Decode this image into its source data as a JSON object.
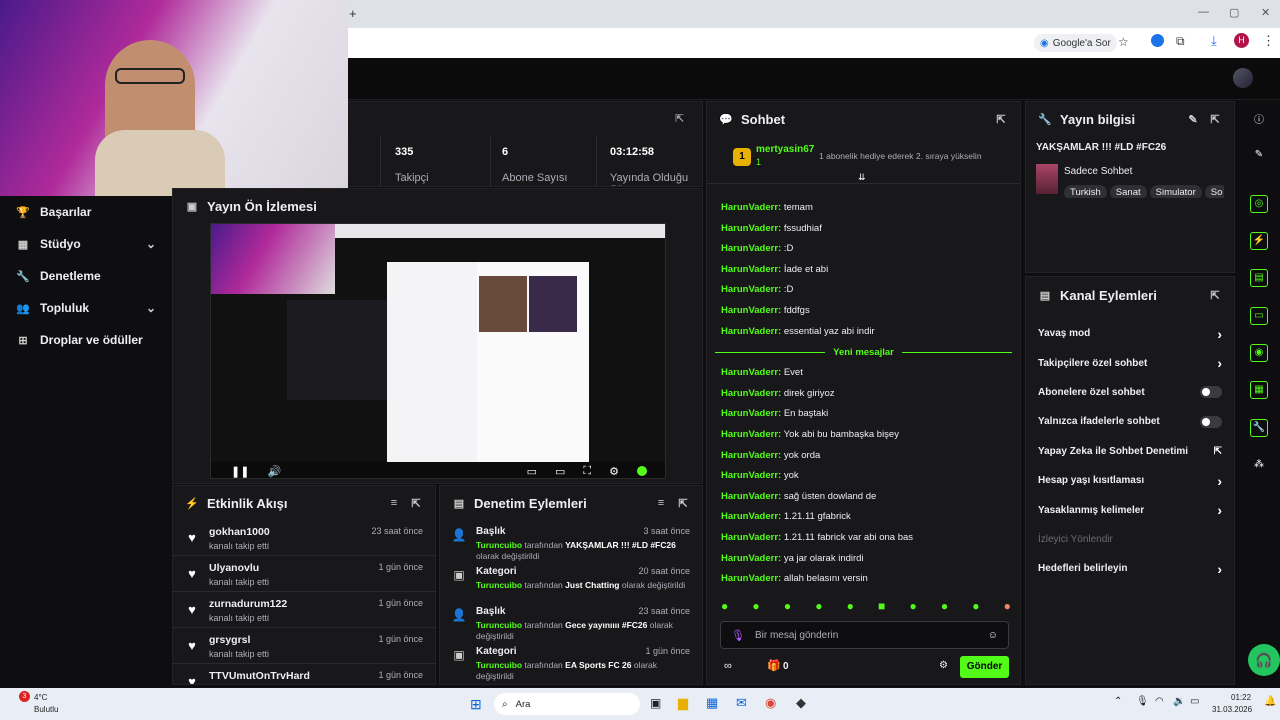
{
  "browser": {
    "new_tab_glyph": "+",
    "ask_label": "Google'a Sor",
    "profile_initial": "H"
  },
  "nav": {
    "items": [
      {
        "label": "Başarılar",
        "icon": "trophy-icon",
        "chevron": false
      },
      {
        "label": "Stüdyo",
        "icon": "studio-icon",
        "chevron": true
      },
      {
        "label": "Denetleme",
        "icon": "wrench-icon",
        "chevron": false
      },
      {
        "label": "Topluluk",
        "icon": "users-icon",
        "chevron": true
      },
      {
        "label": "Droplar ve ödüller",
        "icon": "drops-icon",
        "chevron": false
      }
    ]
  },
  "stats": [
    {
      "value": "335",
      "label": "Takipçi"
    },
    {
      "value": "6",
      "label": "Abone Sayısı"
    },
    {
      "value": "03:12:58",
      "label": "Yayında Olduğu Süre"
    }
  ],
  "preview": {
    "title": "Yayın Ön İzlemesi"
  },
  "feed": {
    "title": "Etkinlik Akışı",
    "items": [
      {
        "name": "gokhan1000",
        "sub": "kanalı takip etti",
        "time": "23 saat önce"
      },
      {
        "name": "Ulyanovlu",
        "sub": "kanalı takip etti",
        "time": "1 gün önce"
      },
      {
        "name": "zurnadurum122",
        "sub": "kanalı takip etti",
        "time": "1 gün önce"
      },
      {
        "name": "grsygrsl",
        "sub": "kanalı takip etti",
        "time": "1 gün önce"
      },
      {
        "name": "TTVUmutOnTrvHard",
        "sub": "",
        "time": "1 gün önce"
      }
    ]
  },
  "mod": {
    "title": "Denetim Eylemleri",
    "items": [
      {
        "type": "Başlık",
        "by": "Turuncuibo",
        "mid": "tarafından",
        "value": "YAKŞAMLAR !!! #LD #FC26",
        "tail": "olarak değiştirildi",
        "time": "3 saat önce"
      },
      {
        "type": "Kategori",
        "by": "Turuncuibo",
        "mid": "tarafından",
        "value": "Just Chatting",
        "tail": "olarak değiştirildi",
        "time": "20 saat önce"
      },
      {
        "type": "Başlık",
        "by": "Turuncuibo",
        "mid": "tarafından",
        "value": "Gece yayınıııı #FC26",
        "tail": "olarak değiştirildi",
        "time": "23 saat önce"
      },
      {
        "type": "Kategori",
        "by": "Turuncuibo",
        "mid": "tarafından",
        "value": "EA Sports FC 26",
        "tail": "olarak değiştirildi",
        "time": "1 gün önce"
      }
    ]
  },
  "chat": {
    "title": "Sohbet",
    "pinned_user": "mertyasin67",
    "pinned_badge": "1",
    "pinned_count": "1",
    "pinned_text": "1 abonelik hediye ederek 2. sıraya yükselin",
    "new_messages": "Yeni mesajlar",
    "messages_before": [
      {
        "user": "HarunVaderr:",
        "text": "temam"
      },
      {
        "user": "HarunVaderr:",
        "text": "fssudhiaf"
      },
      {
        "user": "HarunVaderr:",
        "text": ":D"
      },
      {
        "user": "HarunVaderr:",
        "text": "İade et abi"
      },
      {
        "user": "HarunVaderr:",
        "text": ":D"
      },
      {
        "user": "HarunVaderr:",
        "text": "fddfgs"
      },
      {
        "user": "HarunVaderr:",
        "text": "essential yaz abi indir"
      }
    ],
    "messages_after": [
      {
        "user": "HarunVaderr:",
        "text": "Evet"
      },
      {
        "user": "HarunVaderr:",
        "text": "direk giriyoz"
      },
      {
        "user": "HarunVaderr:",
        "text": "En baştaki"
      },
      {
        "user": "HarunVaderr:",
        "text": "Yok abi bu bambaşka bişey"
      },
      {
        "user": "HarunVaderr:",
        "text": "yok orda"
      },
      {
        "user": "HarunVaderr:",
        "text": "yok"
      },
      {
        "user": "HarunVaderr:",
        "text": "sağ üsten dowland de"
      },
      {
        "user": "HarunVaderr:",
        "text": "1.21.11 gfabrick"
      },
      {
        "user": "HarunVaderr:",
        "text": "1.21.11 fabrick var abi ona bas"
      },
      {
        "user": "HarunVaderr:",
        "text": "ya jar olarak indirdi"
      },
      {
        "user": "HarunVaderr:",
        "text": "allah belasını versin"
      }
    ],
    "input_placeholder": "Bir mesaj gönderin",
    "points": "0",
    "send_label": "Gönder"
  },
  "info": {
    "title": "Yayın bilgisi",
    "stream_title": "YAKŞAMLAR !!! #LD #FC26",
    "category": "Sadece Sohbet",
    "tags": [
      "Turkish",
      "Sanat",
      "Simulator",
      "So"
    ]
  },
  "actions": {
    "title": "Kanal Eylemleri",
    "items": [
      {
        "label": "Yavaş mod",
        "kind": "chevron"
      },
      {
        "label": "Takipçilere özel sohbet",
        "kind": "chevron"
      },
      {
        "label": "Abonelere özel sohbet",
        "kind": "toggle"
      },
      {
        "label": "Yalnızca ifadelerle sohbet",
        "kind": "toggle"
      },
      {
        "label": "Yapay Zeka ile Sohbet Denetimi",
        "kind": "external"
      },
      {
        "label": "Hesap yaşı kısıtlaması",
        "kind": "chevron"
      },
      {
        "label": "Yasaklanmış kelimeler",
        "kind": "chevron"
      },
      {
        "label": "İzleyici Yönlendir",
        "kind": "disabled"
      },
      {
        "label": "Hedefleri belirleyin",
        "kind": "chevron"
      }
    ]
  },
  "taskbar": {
    "weather_temp": "4°C",
    "weather_desc": "Bulutlu",
    "weather_badge": "3",
    "search": "Ara",
    "time": "01:22",
    "date": "31.03.2026"
  },
  "colors": {
    "accent": "#53fc18",
    "panel": "#18181b",
    "bg": "#0e0e10"
  }
}
